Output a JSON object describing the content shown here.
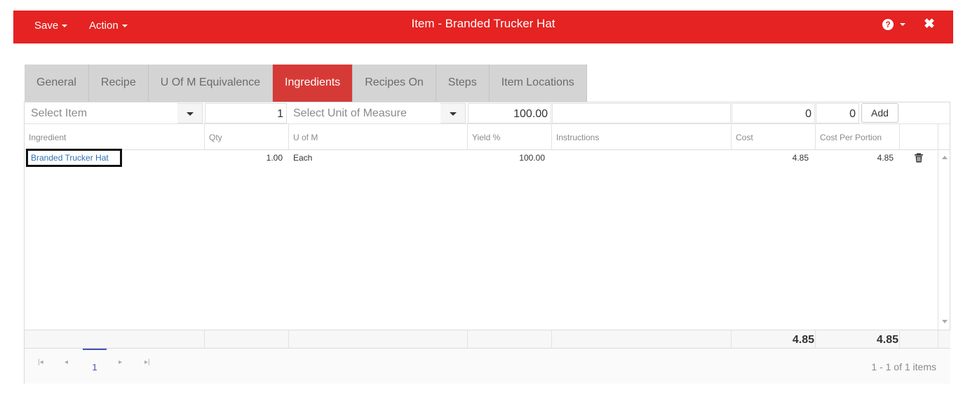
{
  "header": {
    "save_label": "Save",
    "action_label": "Action",
    "title": "Item - Branded Trucker Hat",
    "help_icon": "question-circle-icon",
    "close_icon": "close-icon",
    "accent_color": "#e42322"
  },
  "tabs": [
    {
      "label": "General",
      "active": false
    },
    {
      "label": "Recipe",
      "active": false
    },
    {
      "label": "U Of M Equivalence",
      "active": false
    },
    {
      "label": "Ingredients",
      "active": true
    },
    {
      "label": "Recipes On",
      "active": false
    },
    {
      "label": "Steps",
      "active": false
    },
    {
      "label": "Item Locations",
      "active": false
    }
  ],
  "entry": {
    "item_placeholder": "Select Item",
    "qty_value": "1",
    "uom_placeholder": "Select Unit of Measure",
    "yield_value": "100.00",
    "instructions_value": "",
    "cost_value": "0",
    "cost_per_portion_value": "0",
    "add_label": "Add"
  },
  "columns": [
    "Ingredient",
    "Qty",
    "U of M",
    "Yield %",
    "Instructions",
    "Cost",
    "Cost Per Portion"
  ],
  "rows": [
    {
      "ingredient": "Branded Trucker Hat",
      "qty": "1.00",
      "uom": "Each",
      "yield": "100.00",
      "instructions": "",
      "cost": "4.85",
      "cost_per_portion": "4.85"
    }
  ],
  "totals": {
    "cost": "4.85",
    "cost_per_portion": "4.85"
  },
  "pager": {
    "current_page": "1",
    "info": "1 - 1 of 1 items"
  }
}
